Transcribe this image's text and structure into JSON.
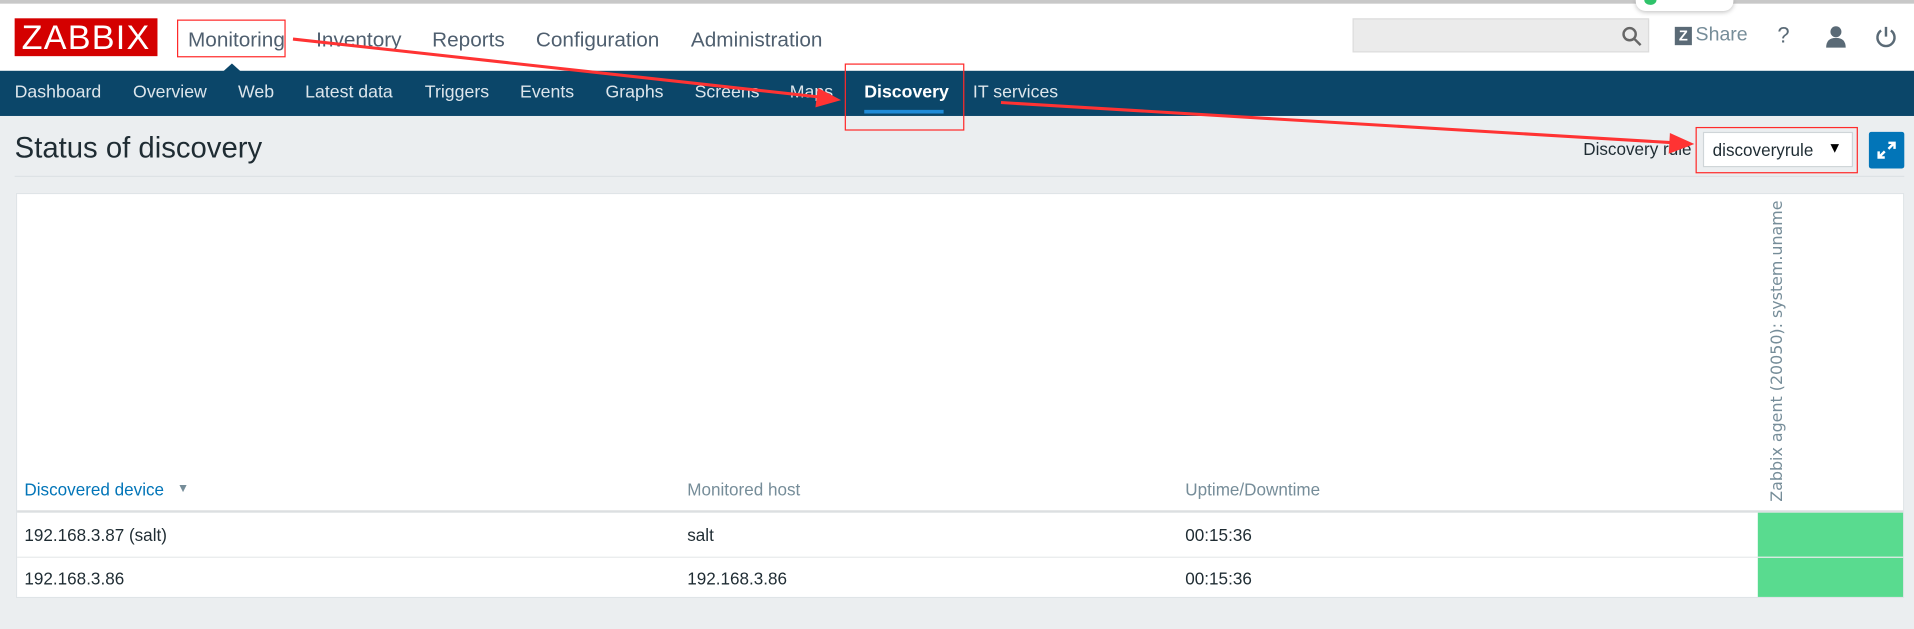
{
  "header": {
    "logo": "ZABBIX",
    "menu": [
      "Monitoring",
      "Inventory",
      "Reports",
      "Configuration",
      "Administration"
    ],
    "search_placeholder": "",
    "share_label": "Share",
    "help_label": "?"
  },
  "nav": {
    "items": [
      "Dashboard",
      "Overview",
      "Web",
      "Latest data",
      "Triggers",
      "Events",
      "Graphs",
      "Screens",
      "Maps",
      "Discovery",
      "IT services"
    ],
    "active": "Discovery"
  },
  "page": {
    "title": "Status of discovery",
    "filter_label": "Discovery rule",
    "filter_value": "discoveryrule"
  },
  "table": {
    "headers": [
      "Discovered device",
      "Monitored host",
      "Uptime/Downtime",
      "Zabbix agent (20050): system.uname"
    ],
    "rows": [
      {
        "device": "192.168.3.87 (salt)",
        "host": "salt",
        "uptime": "00:15:36",
        "status_color": "#59db8f"
      },
      {
        "device": "192.168.3.86",
        "host": "192.168.3.86",
        "uptime": "00:15:36",
        "status_color": "#59db8f"
      }
    ]
  },
  "colors": {
    "nav_bg": "#0b4669",
    "accent": "#0275b8",
    "logo": "#d40000",
    "annotation": "#ff2a2a"
  }
}
